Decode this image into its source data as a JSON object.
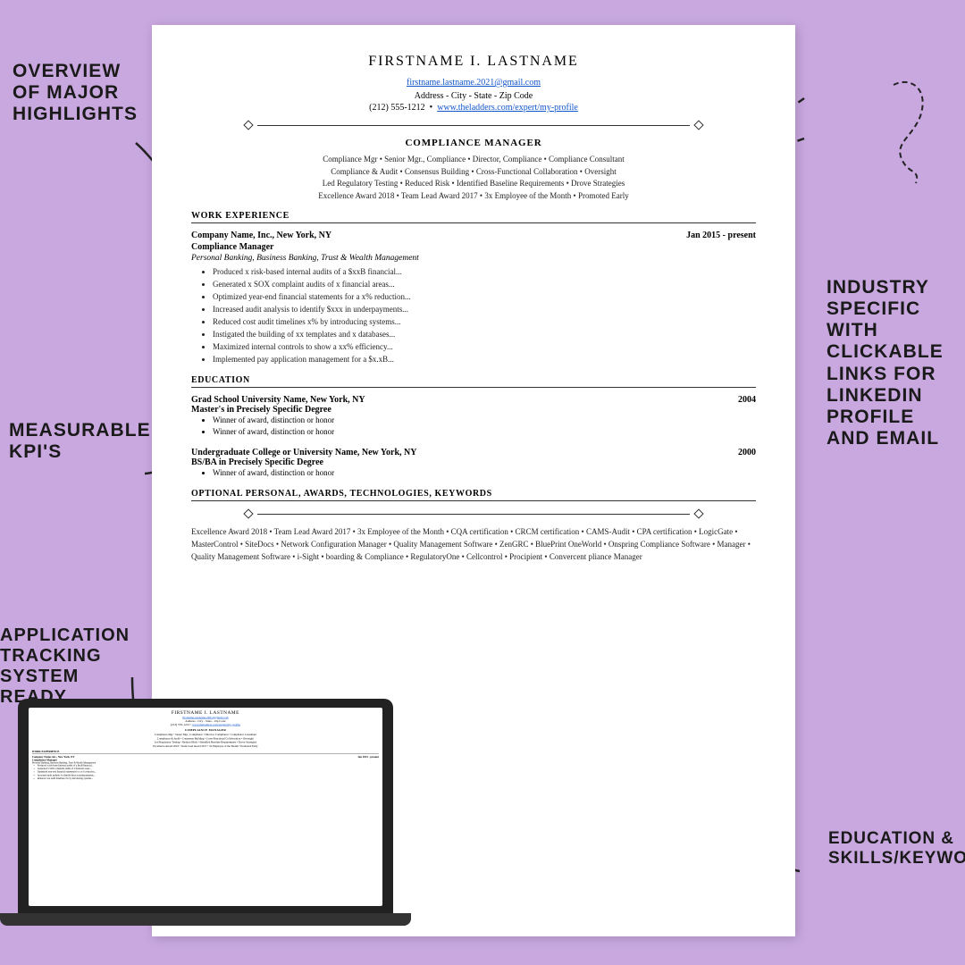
{
  "background_color": "#c9a8e0",
  "labels": {
    "overview": "OVERVIEW\nOF MAJOR\nHIGHLIGHTS",
    "measurable": "MEASURABLE\nKPI'S",
    "ats": "APPLICATION\nTRACKING\nSYSTEM\nREADY",
    "industry": "INDUSTRY\nSPECIFIC\nWITH\nCLICKABLE\nLINKS FOR\nLINKEDIN\nPROFILE\nAND EMAIL",
    "education": "EDUCATION &\nSKILLS/KEYWORDS"
  },
  "resume": {
    "name": "FIRSTNAME I. LASTNAME",
    "email": "firstname.lastname.2021@gmail.com",
    "address": "Address - City - State - Zip Code",
    "phone": "(212) 555-1212",
    "linkedin": "www.theladders.com/expert/my-profile",
    "title": "COMPLIANCE MANAGER",
    "keywords_line1": "Compliance Mgr • Senior Mgr., Compliance • Director, Compliance • Compliance Consultant",
    "keywords_line2": "Compliance & Audit • Consensus Building • Cross-Functional Collaboration • Oversight",
    "keywords_line3": "Led Regulatory Testing • Reduced Risk • Identified Baseline Requirements • Drove Strategies",
    "keywords_line4": "Excellence Award 2018 • Team Lead Award 2017 • 3x Employee of the Month • Promoted Early",
    "sections": {
      "work_experience_label": "WORK EXPERIENCE",
      "company": "Company Name, Inc., New York, NY",
      "dates": "Jan 2015 - present",
      "job_title": "Compliance Manager",
      "industry_line": "Personal Banking, Business Banking, Trust & Wealth Management",
      "bullets": [
        "Produced x risk-based internal audits of a $xxB financial...",
        "Generated x SOX complaint audits of x financial areas...",
        "Optimized year-end financial statements for a x% reduction...",
        "Increased audit analysis to identify $xxx in underpayments...",
        "Reduced cost audit timelines x% by introducing systems...",
        "Instigated the building of xx templates and x databases...",
        "Maximized internal controls to show a xx% efficiency...",
        "Implemented pay application management for a $x.xB..."
      ],
      "education_label": "EDUCATION",
      "grad_school": "Grad School University Name, New York, NY",
      "grad_year": "2004",
      "grad_degree": "Master's in Precisely Specific Degree",
      "grad_bullets": [
        "Winner of award, distinction or honor",
        "Winner of award, distinction or honor"
      ],
      "undergrad_school": "Undergraduate College or University Name, New York, NY",
      "undergrad_year": "2000",
      "undergrad_degree": "BS/BA in Precisely Specific Degree",
      "undergrad_bullets": [
        "Winner of award, distinction or honor"
      ],
      "optional_label": "OPTIONAL PERSONAL, AWARDS, TECHNOLOGIES, KEYWORDS",
      "optional_text": "Excellence Award 2018 • Team Lead Award 2017 • 3x Employee of the Month • CQA certification • CRCM certification • CAMS-Audit • CPA certification • LogicGate • MasterControl • SiteDocs • Network Configuration Manager • Quality Management Software • ZenGRC • BluePrint OneWorld • Onspring Compliance Software • Manager • Quality Management Software • i-Sight • boarding & Compliance • RegulatoryOne • Cellcontrol • Procipient • Convercent pliance Manager"
    }
  }
}
